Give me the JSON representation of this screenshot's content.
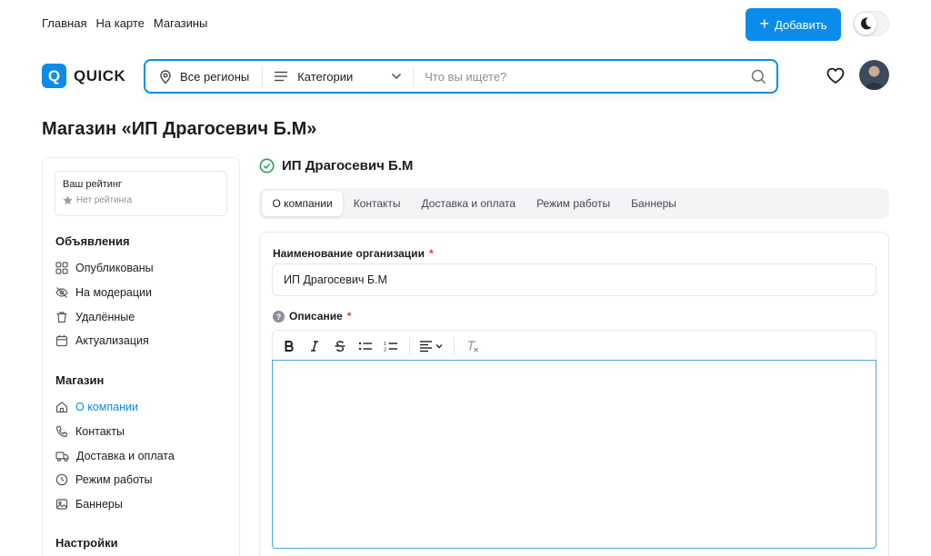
{
  "topnav": {
    "links": [
      "Главная",
      "На карте",
      "Магазины"
    ],
    "add_button": "Добавить"
  },
  "header": {
    "logo_letter": "Q",
    "logo_text": "QUICK",
    "search": {
      "region": "Все регионы",
      "categories": "Категории",
      "placeholder": "Что вы ищете?"
    }
  },
  "page": {
    "title": "Магазин «ИП Драгосевич Б.М»"
  },
  "sidebar": {
    "rating_title": "Ваш рейтинг",
    "rating_value": "Нет рейтинга",
    "sections": [
      {
        "title": "Объявления",
        "items": [
          "Опубликованы",
          "На модерации",
          "Удалённые",
          "Актуализация"
        ]
      },
      {
        "title": "Магазин",
        "items": [
          "О компании",
          "Контакты",
          "Доставка и оплата",
          "Режим работы",
          "Баннеры"
        ]
      },
      {
        "title": "Настройки",
        "items": []
      }
    ]
  },
  "main": {
    "company_name": "ИП Драгосевич Б.М",
    "tabs": [
      "О компании",
      "Контакты",
      "Доставка и оплата",
      "Режим работы",
      "Баннеры"
    ],
    "form": {
      "org_label": "Наименование организации",
      "org_value": "ИП Драгосевич Б.М",
      "desc_label": "Описание",
      "required_mark": "*"
    }
  },
  "colors": {
    "accent": "#0b8ce9",
    "success": "#2e9e5b",
    "required": "#e53935"
  }
}
